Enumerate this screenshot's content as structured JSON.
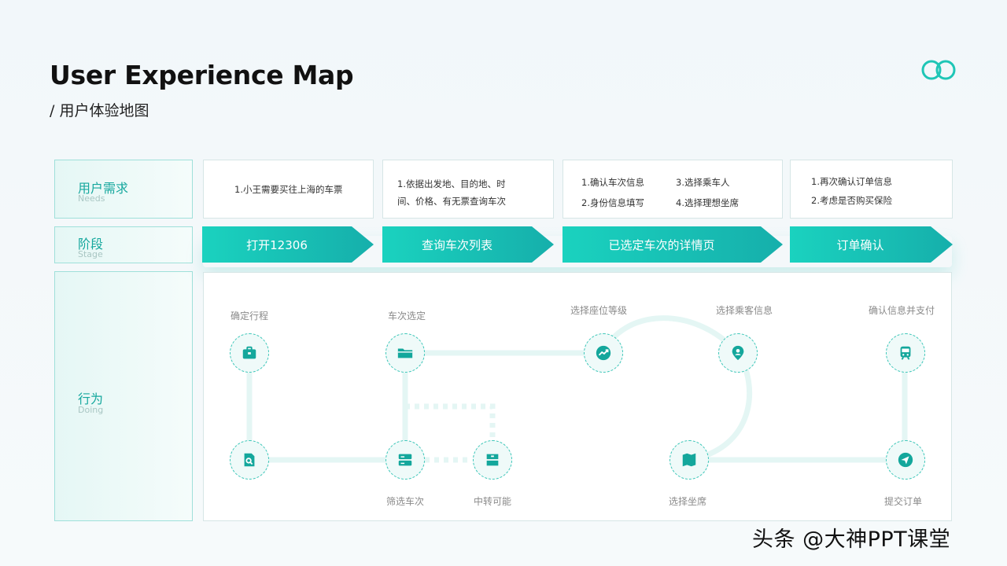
{
  "header": {
    "title": "User Experience Map",
    "subtitle": "/ 用户体验地图"
  },
  "rows": {
    "needs": {
      "zh": "用户需求",
      "en": "Needs"
    },
    "stage": {
      "zh": "阶段",
      "en": "Stage"
    },
    "doing": {
      "zh": "行为",
      "en": "Doing"
    }
  },
  "needs": [
    {
      "lines": [
        "1.小王需要买往上海的车票"
      ]
    },
    {
      "lines": [
        "1.依据出发地、目的地、时",
        "间、价格、有无票查询车次"
      ]
    },
    {
      "cols": [
        [
          "1.确认车次信息",
          "2.身份信息填写"
        ],
        [
          "3.选择乘车人",
          "4.选择理想坐席"
        ]
      ]
    },
    {
      "lines": [
        "1.再次确认订单信息",
        "2.考虑是否购买保险"
      ]
    }
  ],
  "stages": [
    "打开12306",
    "查询车次列表",
    "已选定车次的详情页",
    "订单确认"
  ],
  "nodes": [
    {
      "label": "确定行程",
      "icon": "briefcase-icon"
    },
    {
      "label": "",
      "icon": "search-document-icon"
    },
    {
      "label": "车次选定",
      "icon": "folder-icon"
    },
    {
      "label": "筛选车次",
      "icon": "server-icon"
    },
    {
      "label": "中转可能",
      "icon": "archive-icon"
    },
    {
      "label": "选择座位等级",
      "icon": "trend-icon"
    },
    {
      "label": "选择乘客信息",
      "icon": "location-pin-icon"
    },
    {
      "label": "选择坐席",
      "icon": "map-icon"
    },
    {
      "label": "确认信息并支付",
      "icon": "train-icon"
    },
    {
      "label": "提交订单",
      "icon": "send-icon"
    }
  ],
  "colors": {
    "accent": "#16b5a8",
    "accent_light": "#1dd4c0",
    "path": "#e6f7f5"
  },
  "watermark": "头条 @大神PPT课堂"
}
